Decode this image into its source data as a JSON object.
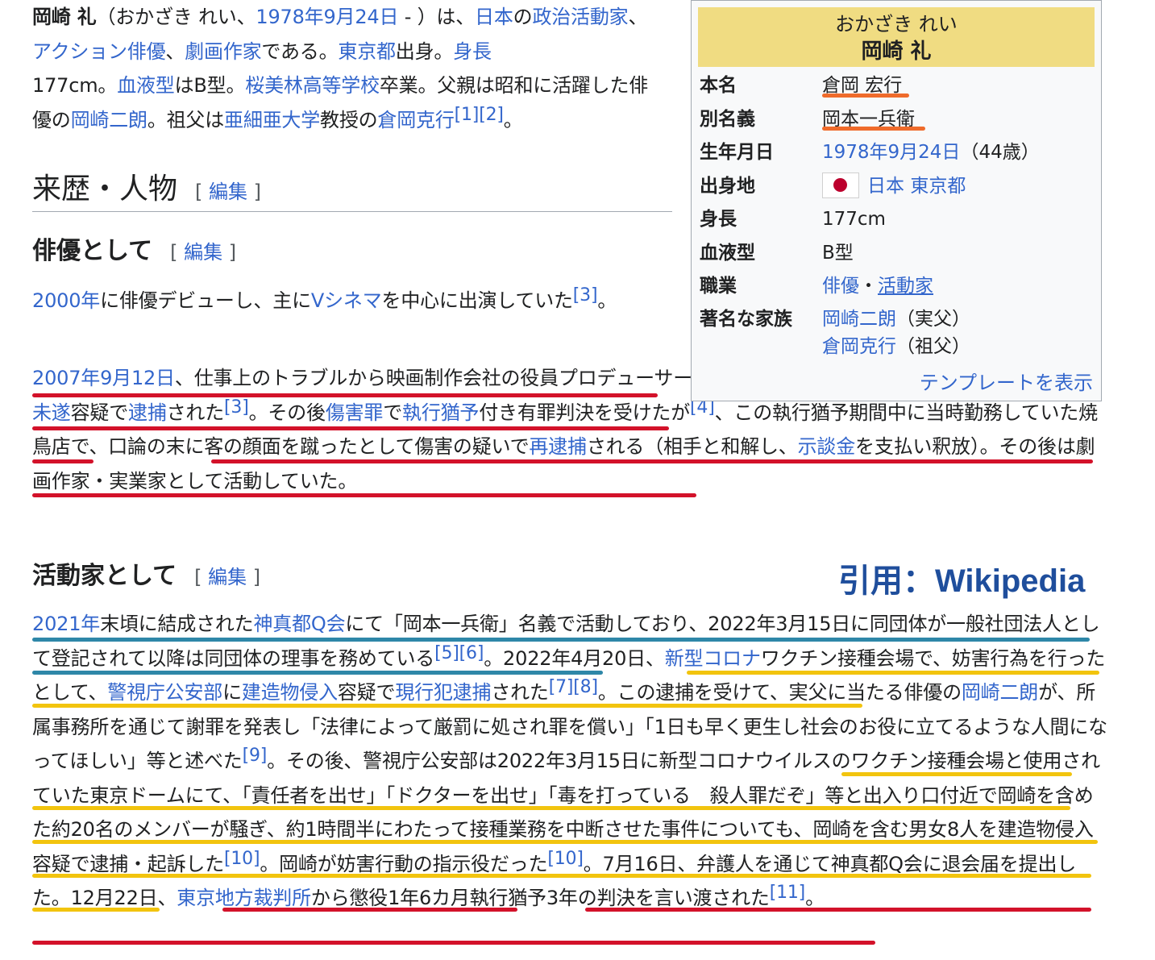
{
  "lead": {
    "subject": "岡崎 礼",
    "reading_open": "（おかざき れい、",
    "birth_link": "1978年9月24日",
    "dash": " - ）は、",
    "link_japan": "日本",
    "t_no": "の",
    "link_politics": "政治活動家",
    "t_comma1": "、",
    "link_action": "アクション俳優",
    "t_comma2": "、",
    "link_gekiga": "劇画作家",
    "t_dearu": "である。",
    "link_tokyo": "東京都",
    "t_birthplace": "出身。",
    "link_height": "身長",
    "t_height": "177cm。",
    "link_blood": "血液型",
    "t_blood": "はB型。",
    "link_school": "桜美林高等学校",
    "t_grad": "卒業。父親は昭和に活躍した俳優の",
    "link_father": "岡崎二朗",
    "t_grand": "。祖父は",
    "link_univ": "亜細亜大学",
    "t_prof": "教授の",
    "link_grandfather": "倉岡克行",
    "ref1": "[1]",
    "ref2": "[2]",
    "t_end": "。"
  },
  "sections": {
    "career": {
      "title": "来歴・人物",
      "edit": "編集"
    },
    "actor": {
      "title": "俳優として",
      "edit": "編集"
    },
    "activist": {
      "title": "活動家として",
      "edit": "編集"
    }
  },
  "actor_p1": {
    "link_2000": "2000年",
    "t1": "に俳優デビューし、主に",
    "link_vcinema": "Vシネマ",
    "t2": "を中心に出演していた",
    "ref3": "[3]",
    "t3": "。"
  },
  "actor_p2": {
    "link_date": "2007年9月12日",
    "t1": "、仕事上のトラブルから映画制作会社の役員プロデューサーの男性を刃物で負傷させる事件を起こし、",
    "link_attempt": "殺人未遂",
    "t2": "容疑で",
    "link_arrest": "逮捕",
    "t3": "された",
    "ref3": "[3]",
    "t4": "。その後",
    "link_injury": "傷害罪",
    "t5": "で",
    "link_suspended": "執行猶予",
    "t6": "付き有罪判決を受けたが",
    "ref4": "[4]",
    "t7": "、この執行猶予期間中に当時勤務していた焼鳥店で、口論の末に客の顔面を蹴ったとして傷害の疑いで",
    "link_rearrest": "再逮捕",
    "t8": "される（相手と和解し、",
    "link_settlement": "示談金",
    "t9": "を支払い釈放）。その後は劇画作家・実業家として活動していた。"
  },
  "activist_p": {
    "link_2021": "2021年",
    "t1": "末頃に結成された",
    "link_shinmato": "神真都Q会",
    "t2": "にて「岡本一兵衛」名義で活動しており、2022年3月15日に同団体が一般社団法人として登記されて以降は同団体の理事を務めている",
    "ref5": "[5]",
    "ref6": "[6]",
    "t3": "。2022年4月20日、",
    "link_corona": "新型コロナ",
    "t4": "ワクチン接種会場で、妨害行為を行ったとして、",
    "link_police": "警視庁公安部",
    "t5": "に",
    "link_trespass": "建造物侵入",
    "t6": "容疑で",
    "link_flagrante": "現行犯逮捕",
    "t7": "された",
    "ref7": "[7]",
    "ref8": "[8]",
    "t8": "。この逮捕を受けて、実父に当たる俳優の",
    "link_father": "岡崎二朗",
    "t9": "が、所属事務所を通じて謝罪を発表し「法律によって厳罰に処され罪を償い」「1日も早く更生し社会のお役に立てるような人間になってほしい」等と述べた",
    "ref9": "[9]",
    "t10": "。その後、警視庁公安部は2022年3月15日に新型コロナウイルスのワクチン接種会場と使用されていた東京ドームにて、「責任者を出せ」「ドクターを出せ」「毒を打っている　殺人罪だぞ」等と出入り口付近で岡崎を含めた約20名のメンバーが騒ぎ、約1時間半にわたって接種業務を中断させた事件についても、岡崎を含む男女8人を建造物侵入容疑で逮捕・起訴した",
    "ref10a": "[10]",
    "t11": "。岡崎が妨害行動の指示役だった",
    "ref10b": "[10]",
    "t12": "。7月16日、弁護人を通じて神真都Q会に退会届を提出した。12月22日、",
    "link_court": "東京地方裁判所",
    "t13": "から懲役1年6カ月執行猶予3年の判決を言い渡された",
    "ref11": "[11]",
    "t14": "。"
  },
  "infobox": {
    "kana": "おかざき れい",
    "name": "岡崎 礼",
    "rows": [
      {
        "label": "本名",
        "value": "倉岡 宏行"
      },
      {
        "label": "別名義",
        "value": "岡本一兵衛"
      },
      {
        "label": "生年月日",
        "value_link": "1978年9月24日",
        "value_extra": "（44歳）"
      },
      {
        "label": "出身地",
        "value_link1": "日本",
        "value_link2": "東京都"
      },
      {
        "label": "身長",
        "value": "177cm"
      },
      {
        "label": "血液型",
        "value": "B型"
      },
      {
        "label": "職業",
        "value_link1": "俳優",
        "sep": "・",
        "value_link2": "活動家"
      },
      {
        "label": "著名な家族",
        "value_link1": "岡崎二朗",
        "extra1": "（実父）",
        "value_link2": "倉岡克行",
        "extra2": "（祖父）"
      }
    ],
    "footer": "テンプレートを表示"
  },
  "citation": "引用：Wikipedia",
  "colors": {
    "link": "#3366cc",
    "infobox_header": "#f0dc82",
    "underline_red": "#d3122a",
    "underline_blue": "#2e87a8",
    "underline_yellow": "#f2c40e",
    "underline_orange": "#ef6b2b",
    "citation": "#1f4e9c"
  }
}
